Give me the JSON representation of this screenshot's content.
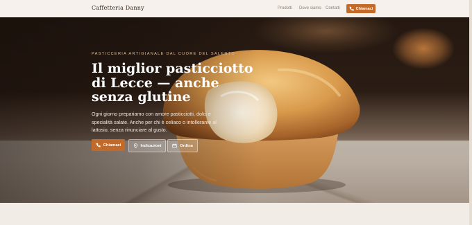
{
  "header": {
    "brand": "Caffetteria Danny",
    "nav": [
      {
        "label": "Prodotti"
      },
      {
        "label": "Dove siamo"
      },
      {
        "label": "Contatti"
      }
    ],
    "call_button": {
      "label": "Chiamaci",
      "icon": "phone-icon"
    }
  },
  "hero": {
    "eyebrow": "Pasticceria artigianale dal cuore del Salento",
    "headline": "Il miglior pasticciotto di Lecce — anche senza glutine",
    "lede": "Ogni giorno prepariamo con amore pasticciotti, dolci e specialità salate. Anche per chi è celiaco o intollerante al lattosio, senza rinunciare al gusto.",
    "buttons": [
      {
        "label": "Chiamaci",
        "icon": "phone-icon"
      },
      {
        "label": "Indicazioni",
        "icon": "map-pin-icon"
      },
      {
        "label": "Ordina",
        "icon": "calendar-icon"
      }
    ]
  },
  "colors": {
    "accent": "#c26a2a",
    "header_bg": "#f6f1ec",
    "eyebrow": "#e0b98f"
  }
}
